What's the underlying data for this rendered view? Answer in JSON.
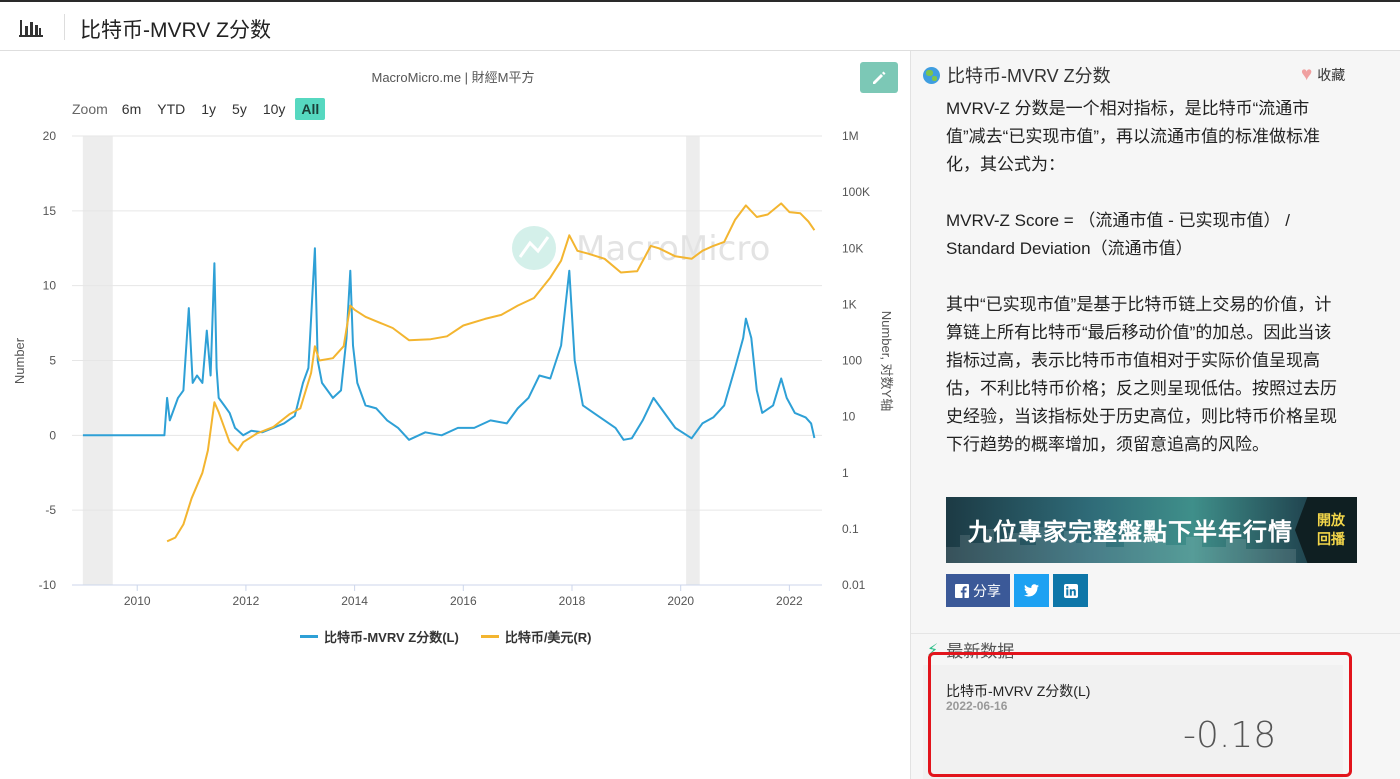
{
  "header": {
    "title": "比特币-MVRV Z分数",
    "logo_icon": "chart-bars-icon"
  },
  "chart_panel": {
    "source": "MacroMicro.me | 財經M平方",
    "edit_icon": "pencil-icon",
    "zoom": {
      "label": "Zoom",
      "options": [
        "6m",
        "YTD",
        "1y",
        "5y",
        "10y",
        "All"
      ],
      "active": "All"
    }
  },
  "chart_data": {
    "type": "line",
    "title": "",
    "watermark": "MacroMicro",
    "xlabel": "",
    "ylabel_left": "Number",
    "ylabel_right": "Number, 对数Y轴",
    "xlim": [
      2008.8,
      2022.6
    ],
    "ylim_left": [
      -10,
      20
    ],
    "ylim_right_log": [
      0.01,
      1000000
    ],
    "x_ticks": [
      "2010",
      "2012",
      "2014",
      "2016",
      "2018",
      "2020",
      "2022"
    ],
    "y_ticks_left": [
      "20",
      "15",
      "10",
      "5",
      "0",
      "-5",
      "-10"
    ],
    "y_ticks_right": [
      "1M",
      "100K",
      "10K",
      "1K",
      "100",
      "10",
      "1",
      "0.1",
      "0.01"
    ],
    "shaded_ranges": [
      [
        2009.0,
        2009.55
      ],
      [
        2020.1,
        2020.35
      ]
    ],
    "grid": true,
    "legend_position": "bottom",
    "series": [
      {
        "name": "比特币-MVRV Z分数(L)",
        "axis": "left",
        "color": "#2ea0d6",
        "points": [
          [
            2009.0,
            0
          ],
          [
            2010.5,
            0
          ],
          [
            2010.55,
            2.5
          ],
          [
            2010.6,
            1.0
          ],
          [
            2010.75,
            2.5
          ],
          [
            2010.85,
            3.0
          ],
          [
            2010.95,
            8.5
          ],
          [
            2011.02,
            3.5
          ],
          [
            2011.1,
            4.0
          ],
          [
            2011.2,
            3.5
          ],
          [
            2011.28,
            7.0
          ],
          [
            2011.35,
            4.0
          ],
          [
            2011.42,
            11.5
          ],
          [
            2011.46,
            4.5
          ],
          [
            2011.5,
            2.5
          ],
          [
            2011.6,
            2.0
          ],
          [
            2011.7,
            1.5
          ],
          [
            2011.8,
            0.5
          ],
          [
            2011.95,
            0.0
          ],
          [
            2012.1,
            0.3
          ],
          [
            2012.3,
            0.2
          ],
          [
            2012.5,
            0.5
          ],
          [
            2012.7,
            0.8
          ],
          [
            2012.9,
            1.3
          ],
          [
            2013.05,
            3.5
          ],
          [
            2013.15,
            4.5
          ],
          [
            2013.27,
            12.5
          ],
          [
            2013.32,
            5.0
          ],
          [
            2013.4,
            3.5
          ],
          [
            2013.6,
            2.5
          ],
          [
            2013.75,
            3.0
          ],
          [
            2013.85,
            6.5
          ],
          [
            2013.92,
            11.0
          ],
          [
            2013.97,
            6.0
          ],
          [
            2014.05,
            3.5
          ],
          [
            2014.2,
            2.0
          ],
          [
            2014.4,
            1.8
          ],
          [
            2014.6,
            1.0
          ],
          [
            2014.8,
            0.5
          ],
          [
            2015.0,
            -0.3
          ],
          [
            2015.3,
            0.2
          ],
          [
            2015.6,
            0.0
          ],
          [
            2015.9,
            0.5
          ],
          [
            2016.2,
            0.5
          ],
          [
            2016.5,
            1.0
          ],
          [
            2016.8,
            0.8
          ],
          [
            2017.0,
            1.8
          ],
          [
            2017.2,
            2.5
          ],
          [
            2017.4,
            4.0
          ],
          [
            2017.6,
            3.8
          ],
          [
            2017.8,
            6.0
          ],
          [
            2017.95,
            11.0
          ],
          [
            2018.05,
            5.0
          ],
          [
            2018.2,
            2.0
          ],
          [
            2018.4,
            1.5
          ],
          [
            2018.6,
            1.0
          ],
          [
            2018.8,
            0.5
          ],
          [
            2018.95,
            -0.3
          ],
          [
            2019.1,
            -0.2
          ],
          [
            2019.3,
            1.0
          ],
          [
            2019.5,
            2.5
          ],
          [
            2019.7,
            1.5
          ],
          [
            2019.9,
            0.5
          ],
          [
            2020.2,
            -0.2
          ],
          [
            2020.4,
            0.8
          ],
          [
            2020.6,
            1.2
          ],
          [
            2020.8,
            2.0
          ],
          [
            2021.0,
            4.5
          ],
          [
            2021.15,
            6.5
          ],
          [
            2021.2,
            7.8
          ],
          [
            2021.3,
            6.5
          ],
          [
            2021.4,
            3.0
          ],
          [
            2021.5,
            1.5
          ],
          [
            2021.7,
            2.0
          ],
          [
            2021.85,
            3.8
          ],
          [
            2021.95,
            2.5
          ],
          [
            2022.1,
            1.5
          ],
          [
            2022.3,
            1.2
          ],
          [
            2022.4,
            0.8
          ],
          [
            2022.46,
            -0.18
          ]
        ]
      },
      {
        "name": "比特币/美元(R)",
        "axis": "right",
        "color": "#f3b530",
        "points": [
          [
            2010.55,
            0.06
          ],
          [
            2010.7,
            0.07
          ],
          [
            2010.85,
            0.12
          ],
          [
            2011.0,
            0.35
          ],
          [
            2011.2,
            1.0
          ],
          [
            2011.3,
            2.5
          ],
          [
            2011.42,
            18
          ],
          [
            2011.5,
            12
          ],
          [
            2011.7,
            3.5
          ],
          [
            2011.85,
            2.5
          ],
          [
            2011.95,
            3.5
          ],
          [
            2012.2,
            5
          ],
          [
            2012.5,
            6.5
          ],
          [
            2012.8,
            11
          ],
          [
            2013.0,
            14
          ],
          [
            2013.2,
            60
          ],
          [
            2013.27,
            180
          ],
          [
            2013.35,
            100
          ],
          [
            2013.6,
            110
          ],
          [
            2013.8,
            180
          ],
          [
            2013.92,
            950
          ],
          [
            2014.0,
            800
          ],
          [
            2014.2,
            600
          ],
          [
            2014.4,
            500
          ],
          [
            2014.7,
            380
          ],
          [
            2015.0,
            230
          ],
          [
            2015.4,
            240
          ],
          [
            2015.7,
            270
          ],
          [
            2016.0,
            420
          ],
          [
            2016.4,
            550
          ],
          [
            2016.7,
            650
          ],
          [
            2017.0,
            950
          ],
          [
            2017.3,
            1300
          ],
          [
            2017.6,
            3000
          ],
          [
            2017.8,
            6000
          ],
          [
            2017.95,
            17000
          ],
          [
            2018.1,
            9000
          ],
          [
            2018.3,
            8000
          ],
          [
            2018.6,
            6500
          ],
          [
            2018.9,
            3700
          ],
          [
            2019.2,
            3900
          ],
          [
            2019.45,
            11000
          ],
          [
            2019.6,
            10000
          ],
          [
            2019.9,
            7200
          ],
          [
            2020.2,
            6500
          ],
          [
            2020.4,
            9000
          ],
          [
            2020.6,
            11000
          ],
          [
            2020.8,
            13000
          ],
          [
            2021.0,
            32000
          ],
          [
            2021.2,
            58000
          ],
          [
            2021.4,
            36000
          ],
          [
            2021.6,
            40000
          ],
          [
            2021.85,
            63000
          ],
          [
            2022.0,
            44000
          ],
          [
            2022.2,
            42000
          ],
          [
            2022.35,
            30000
          ],
          [
            2022.46,
            21000
          ]
        ]
      }
    ]
  },
  "side_panel": {
    "title": "比特币-MVRV Z分数",
    "title_icon": "globe-icon",
    "favorite_label": "收藏",
    "favorite_icon": "heart-icon",
    "description": {
      "p1": "MVRV-Z 分数是一个相对指标，是比特币“流通市值”减去“已实现市值”，再以流通市值的标准做标准化，其公式为：",
      "p2": "MVRV-Z Score = （流通市值 - 已实现市值） / Standard Deviation（流通市值）",
      "p3": "其中“已实现市值”是基于比特币链上交易的价值，计算链上所有比特币“最后移动价值”的加总。因此当该指标过高，表示比特币市值相对于实际价值呈现高估，不利比特币价格；反之则呈现低估。按照过去历史经验，当该指标处于历史高位，则比特币价格呈现下行趋势的概率增加，须留意追高的风险。"
    },
    "banner": {
      "text": "九位專家完整盤點下半年行情",
      "replay_line1": "開放",
      "replay_line2": "回播"
    },
    "share": {
      "facebook_label": "分享",
      "facebook_icon": "facebook-icon",
      "twitter_icon": "twitter-icon",
      "linkedin_icon": "linkedin-icon"
    },
    "latest": {
      "heading": "最新数据",
      "heading_icon": "lightning-icon",
      "series_name": "比特币-MVRV Z分数(L)",
      "date": "2022-06-16",
      "value": "-0.18"
    }
  },
  "colors": {
    "accent": "#56d8c0",
    "blue_series": "#2ea0d6",
    "orange_series": "#f3b530",
    "highlight_box": "#e2141c"
  }
}
